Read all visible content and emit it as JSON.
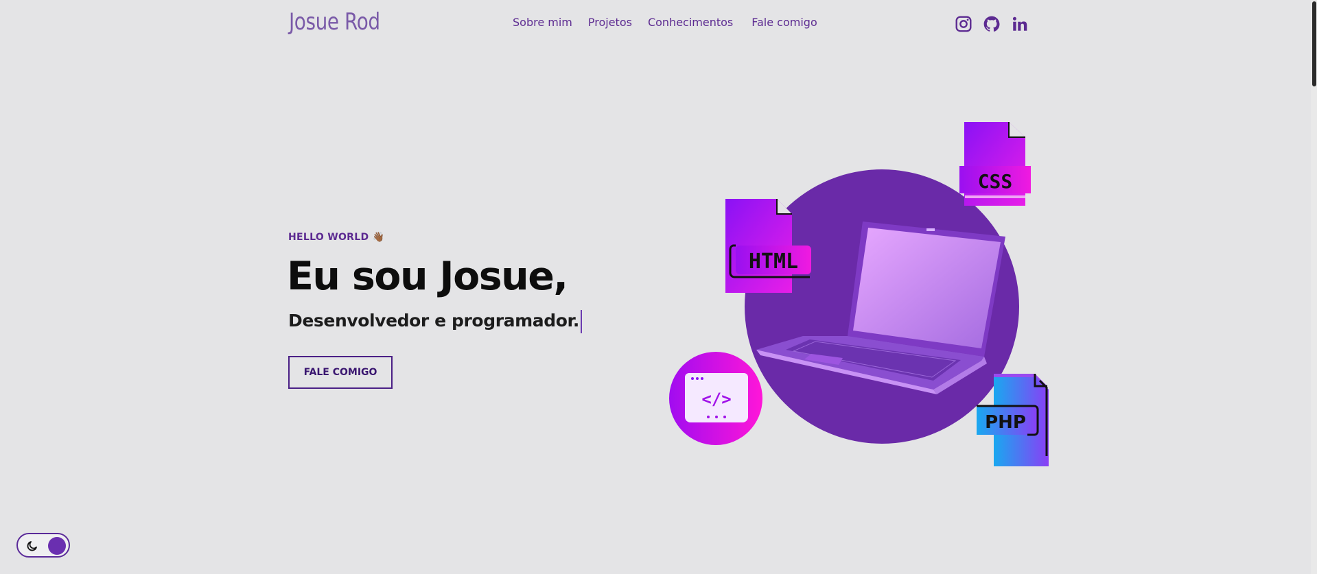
{
  "header": {
    "logo": "Josue Rod",
    "nav": [
      {
        "label": "Sobre mim"
      },
      {
        "label": "Projetos"
      },
      {
        "label": "Conhecimentos"
      },
      {
        "label": "Fale comigo"
      }
    ],
    "social_icons": [
      "instagram-icon",
      "github-icon",
      "linkedin-icon"
    ]
  },
  "hero": {
    "eyebrow": "HELLO WORLD",
    "eyebrow_emoji": "👋🏾",
    "headline": "Eu sou Josue,",
    "subhead": "Desenvolvedor e programador.",
    "cta_label": "FALE COMIGO"
  },
  "illustration": {
    "badges": [
      "HTML",
      "CSS",
      "PHP"
    ],
    "code_symbol": "</>"
  },
  "theme_toggle": {
    "mode": "dark-mode-toggle",
    "icon": "moon-icon"
  },
  "colors": {
    "accent": "#5c2a91",
    "purple_circle": "#6a2aa8",
    "background": "#e4e4e6"
  }
}
